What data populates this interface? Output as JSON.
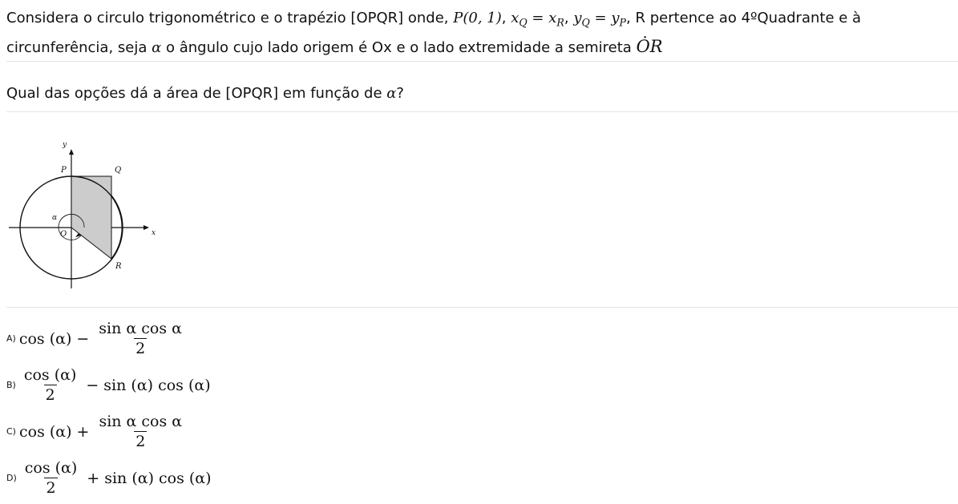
{
  "statement": {
    "part1": "Considera o circulo trigonométrico e o trapézio [OPQR] onde, ",
    "math1": "P(0, 1)",
    "sep1": ", ",
    "math2_a": "x",
    "math2_asub": "Q",
    "math2_b": " = x",
    "math2_bsub": "R",
    "sep2": ", ",
    "math3_a": "y",
    "math3_asub": "Q",
    "math3_b": " = y",
    "math3_bsub": "P",
    "part2": ", R pertence ao 4ºQuadrante e à circunferência, seja ",
    "alpha": "α",
    "part3": " o ângulo cujo lado origem é Ox e o lado extremidade a semireta ",
    "or": "ȮR"
  },
  "question": {
    "text": "Qual das opções dá a área de [OPQR] em função de ",
    "alpha": "α",
    "end": "?"
  },
  "figure": {
    "y_label": "y",
    "x_label": "x",
    "p_label": "P",
    "q_label": "Q",
    "o_label": "O",
    "r_label": "R",
    "alpha_label": "α"
  },
  "options": [
    {
      "label": "A)",
      "lead": "cos (α)",
      "op": "−",
      "num": "sin α cos α",
      "den": "2",
      "tail": ""
    },
    {
      "label": "B)",
      "num": "cos (α)",
      "den": "2",
      "op": "−",
      "tail": "sin (α) cos (α)"
    },
    {
      "label": "C)",
      "lead": "cos (α)",
      "op": "+",
      "num": "sin α cos α",
      "den": "2",
      "tail": ""
    },
    {
      "label": "D)",
      "num": "cos (α)",
      "den": "2",
      "op": "+",
      "tail": "sin (α) cos (α)"
    }
  ]
}
